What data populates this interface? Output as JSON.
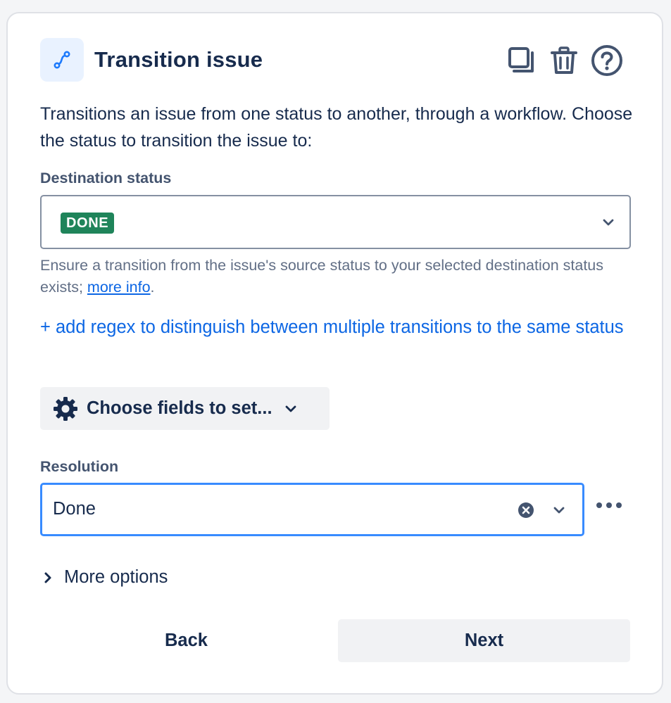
{
  "header": {
    "title": "Transition issue",
    "icon": "transition-icon",
    "actions": [
      {
        "name": "copy-icon"
      },
      {
        "name": "trash-icon"
      },
      {
        "name": "help-icon"
      }
    ]
  },
  "description": "Transitions an issue from one status to another, through a workflow. Choose the status to transition the issue to:",
  "destination": {
    "label": "Destination status",
    "value": "DONE",
    "value_color": "#1f845a"
  },
  "helper": {
    "text": "Ensure a transition from the issue's source status to your selected destination status exists; ",
    "link": "more info",
    "suffix": "."
  },
  "regex_link": "+ add regex to distinguish between multiple transitions to the same status",
  "fields_button": {
    "label": "Choose fields to set...",
    "icon": "gear-icon"
  },
  "resolution": {
    "label": "Resolution",
    "value": "Done"
  },
  "more_options": "More options",
  "footer": {
    "back": "Back",
    "next": "Next"
  },
  "colors": {
    "accent": "#0c66e4",
    "focus_border": "#388bff",
    "text": "#172b4d",
    "subtle_text": "#626f86"
  }
}
